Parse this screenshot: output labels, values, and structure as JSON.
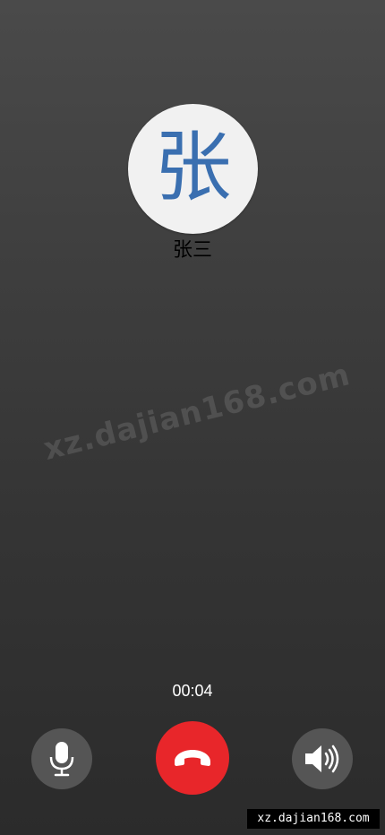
{
  "call": {
    "avatar_initial": "张",
    "caller_name": "张三",
    "duration": "00:04"
  },
  "controls": {
    "mute_icon": "microphone-icon",
    "hangup_icon": "phone-hangup-icon",
    "speaker_icon": "speaker-icon"
  },
  "watermark": {
    "text": "xz.dajian168.com"
  },
  "footer": {
    "tag": "xz.dajian168.com"
  },
  "colors": {
    "hangup": "#e8262a",
    "control_bg": "#555555",
    "avatar_bg": "#f1f1f1",
    "avatar_text": "#3a6fb0"
  }
}
